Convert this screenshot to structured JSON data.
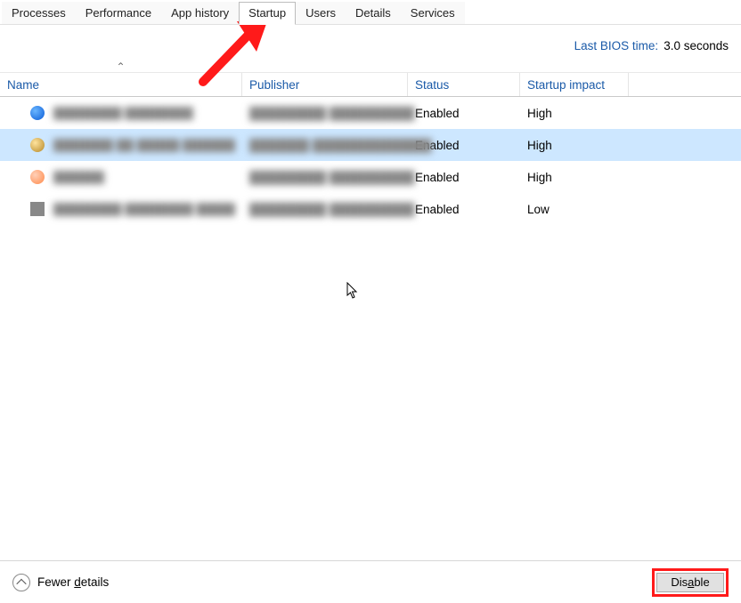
{
  "tabs": [
    {
      "label": "Processes",
      "active": false
    },
    {
      "label": "Performance",
      "active": false
    },
    {
      "label": "App history",
      "active": false
    },
    {
      "label": "Startup",
      "active": true
    },
    {
      "label": "Users",
      "active": false
    },
    {
      "label": "Details",
      "active": false
    },
    {
      "label": "Services",
      "active": false
    }
  ],
  "bios": {
    "label": "Last BIOS time:",
    "value": "3.0 seconds"
  },
  "columns": {
    "name": "Name",
    "publisher": "Publisher",
    "status": "Status",
    "impact": "Startup impact"
  },
  "rows": [
    {
      "icon": "ic-blue",
      "name_blur": "████████ ████████",
      "publisher_blur": "█████████ ██████████",
      "status": "Enabled",
      "impact": "High",
      "selected": false
    },
    {
      "icon": "ic-gold",
      "name_blur": "███████ ██ █████ ████████",
      "publisher_blur": "███████ ██████████████",
      "status": "Enabled",
      "impact": "High",
      "selected": true
    },
    {
      "icon": "ic-orange",
      "name_blur": "██████",
      "publisher_blur": "█████████ ██████████",
      "status": "Enabled",
      "impact": "High",
      "selected": false
    },
    {
      "icon": "ic-shield",
      "name_blur": "████████ ████████ ████████",
      "publisher_blur": "█████████ ██████████",
      "status": "Enabled",
      "impact": "Low",
      "selected": false
    }
  ],
  "footer": {
    "fewer_prefix": "Fewer ",
    "fewer_u": "d",
    "fewer_suffix": "etails",
    "disable_prefix": "Dis",
    "disable_u": "a",
    "disable_suffix": "ble"
  },
  "annotation": {
    "arrow_color": "#ff1a1a",
    "highlight_color": "#ff1a1a"
  }
}
